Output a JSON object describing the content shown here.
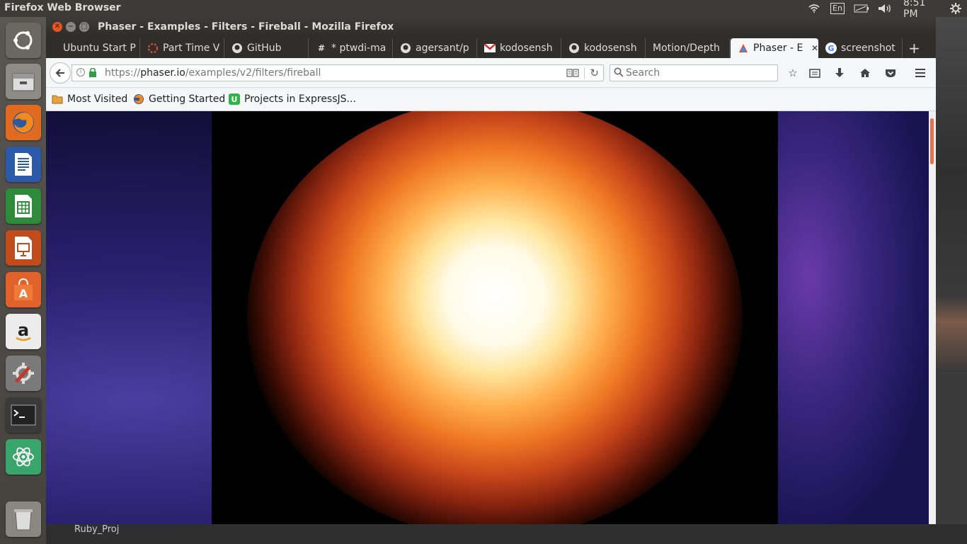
{
  "topbar": {
    "app_title": "Firefox Web Browser",
    "keyboard_layout": "En",
    "clock": "8:51 PM"
  },
  "window": {
    "title": "Phaser - Examples - Filters - Fireball - Mozilla Firefox"
  },
  "tabs": [
    {
      "label": "Ubuntu Start P",
      "icon": "none"
    },
    {
      "label": "Part Time V",
      "icon": "spinner-icon"
    },
    {
      "label": "GitHub",
      "icon": "github-icon"
    },
    {
      "label": "* ptwdi-ma",
      "icon": "hash-icon"
    },
    {
      "label": "agersant/p",
      "icon": "github-icon"
    },
    {
      "label": "kodosensh",
      "icon": "gmail-icon"
    },
    {
      "label": "kodosensh",
      "icon": "github-icon"
    },
    {
      "label": "Motion/Depth",
      "icon": "none"
    },
    {
      "label": "Phaser - E",
      "icon": "phaser-icon"
    },
    {
      "label": "screenshot",
      "icon": "google-icon"
    }
  ],
  "navbar": {
    "url_prefix": "https://",
    "url_host": "phaser.io",
    "url_path": "/examples/v2/filters/fireball",
    "search_placeholder": "Search"
  },
  "bookmarks": [
    {
      "label": "Most Visited",
      "icon": "folder-icon"
    },
    {
      "label": "Getting Started",
      "icon": "firefox-icon"
    },
    {
      "label": "Projects in ExpressJS...",
      "icon": "udemy-icon"
    }
  ],
  "desktop": {
    "behind_label": "Ruby_Proj"
  },
  "launcher": [
    {
      "name": "ubuntu-dash"
    },
    {
      "name": "files"
    },
    {
      "name": "firefox"
    },
    {
      "name": "writer"
    },
    {
      "name": "calc"
    },
    {
      "name": "impress"
    },
    {
      "name": "software-center"
    },
    {
      "name": "amazon"
    },
    {
      "name": "system-settings"
    },
    {
      "name": "terminal"
    },
    {
      "name": "atom"
    },
    {
      "name": "trash"
    }
  ],
  "colors": {
    "ambiance_dark": "#3c3b37",
    "firefox_orange": "#e8704a",
    "space_purple": "#2a2170"
  }
}
